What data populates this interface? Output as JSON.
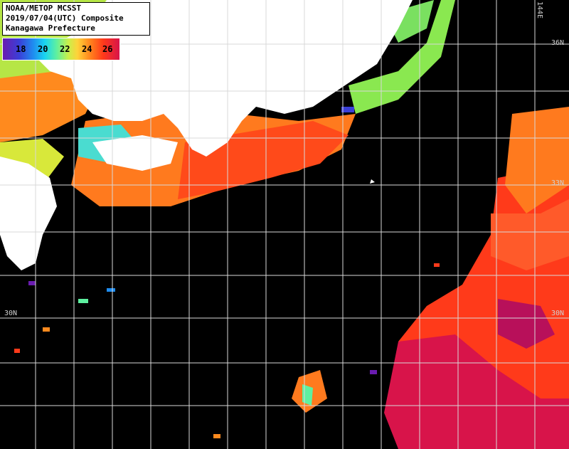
{
  "title": {
    "line1": "NOAA/METOP MCSST",
    "line2": "2019/07/04(UTC) Composite",
    "line3": "Kanagawa Prefecture"
  },
  "legend": {
    "ticks": [
      "18",
      "20",
      "22",
      "24",
      "26"
    ]
  },
  "labels": {
    "lat_36": "36N",
    "lat_30_left": "30N",
    "lat_30_right": "30N",
    "lat_33": "33N",
    "lon_144": "144E"
  },
  "colors": {
    "land": "#ffffff",
    "ocean_nodata": "#000000",
    "grid": "#d8d8d8",
    "sst_cool": "#19d4f0",
    "sst_mid": "#c8f04a",
    "sst_warm": "#ff8a1e",
    "sst_hot": "#ff3a1a",
    "sst_hottest": "#d8144a"
  }
}
